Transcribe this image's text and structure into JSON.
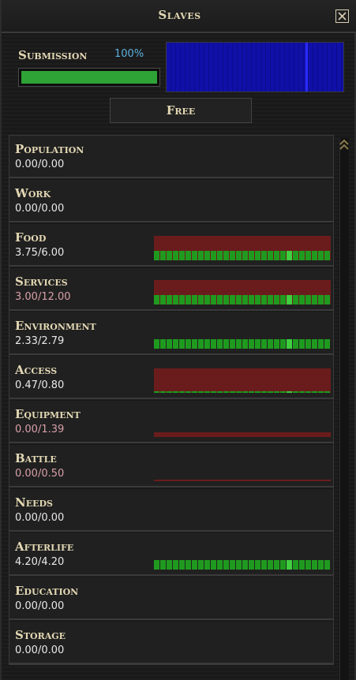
{
  "window": {
    "title": "Slaves",
    "close_icon": "close-x-icon"
  },
  "submission": {
    "label": "Submission",
    "percent_text": "100%",
    "fill_fraction": 1.0,
    "bar_color": "#2ea336",
    "graph_color": "#0c0c8c"
  },
  "free_button": {
    "label": "Free"
  },
  "colors": {
    "label": "#e3d8b4",
    "value_ok": "#e8e8e8",
    "value_short": "#d9a0a8",
    "supply_bar": "#1f9a1f",
    "need_area": "#6a1c1c"
  },
  "needs": [
    {
      "label": "Population",
      "value": "0.00/0.00",
      "short": false,
      "need": 0,
      "supply": 0
    },
    {
      "label": "Work",
      "value": "0.00/0.00",
      "short": false,
      "need": 0,
      "supply": 0
    },
    {
      "label": "Food",
      "value": "3.75/6.00",
      "short": false,
      "need": 6.0,
      "supply": 3.75
    },
    {
      "label": "Services",
      "value": "3.00/12.00",
      "short": true,
      "need": 12.0,
      "supply": 3.0
    },
    {
      "label": "Environment",
      "value": "2.33/2.79",
      "short": false,
      "need": 2.79,
      "supply": 2.33
    },
    {
      "label": "Access",
      "value": "0.47/0.80",
      "short": false,
      "need": 0.8,
      "supply": 0.47
    },
    {
      "label": "Equipment",
      "value": "0.00/1.39",
      "short": true,
      "need": 1.39,
      "supply": 0
    },
    {
      "label": "Battle",
      "value": "0.00/0.50",
      "short": true,
      "need": 0.5,
      "supply": 0
    },
    {
      "label": "Needs",
      "value": "0.00/0.00",
      "short": false,
      "need": 0,
      "supply": 0
    },
    {
      "label": "Afterlife",
      "value": "4.20/4.20",
      "short": false,
      "need": 4.2,
      "supply": 4.2
    },
    {
      "label": "Education",
      "value": "0.00/0.00",
      "short": false,
      "need": 0,
      "supply": 0
    },
    {
      "label": "Storage",
      "value": "0.00/0.00",
      "short": false,
      "need": 0,
      "supply": 0
    }
  ]
}
